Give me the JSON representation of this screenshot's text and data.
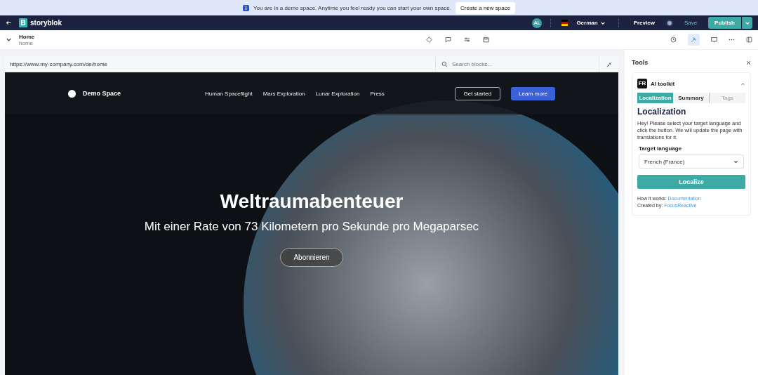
{
  "banner": {
    "message": "You are in a demo space. Anytime you feel ready you can start your own space.",
    "button": "Create a new space"
  },
  "header": {
    "logo": "B",
    "brand": "storyblok",
    "avatar": "AL",
    "language": "German",
    "preview": "Preview",
    "save": "Save",
    "publish": "Publish"
  },
  "story": {
    "title": "Home",
    "slug": "home"
  },
  "preview": {
    "url": "https://www.my-company.com/de/home",
    "search": {
      "placeholder": "Search blocks..."
    },
    "site": {
      "brand": "Demo Space",
      "nav": [
        "Human Spaceflight",
        "Mars Exploration",
        "Lunar Exploration",
        "Press"
      ],
      "buttons": [
        "Get started",
        "Learn more"
      ],
      "headline": "Weltraumabenteuer",
      "subheadline": "Mit einer Rate von 73 Kilometern pro Sekunde pro Megaparsec",
      "cta": "Abonnieren"
    }
  },
  "tools": {
    "title": "Tools",
    "plugin": {
      "logo": "FR",
      "name": "AI toolkit",
      "expanded": true,
      "tabs": [
        {
          "label": "Localization",
          "selected": true,
          "disabled": false
        },
        {
          "label": "Summary",
          "selected": false,
          "disabled": false
        },
        {
          "label": "Tags",
          "selected": false,
          "disabled": true
        }
      ],
      "heading": "Localization",
      "description": "Hey! Please select your target language and click the button. We will update the page with translations for it.",
      "field_label": "Target language",
      "select_value": "French (France)",
      "button": "Localize",
      "how_label": "How it works:",
      "how_link": "Documentation",
      "created_label": "Created by:",
      "created_link": "FocusReactive"
    }
  }
}
